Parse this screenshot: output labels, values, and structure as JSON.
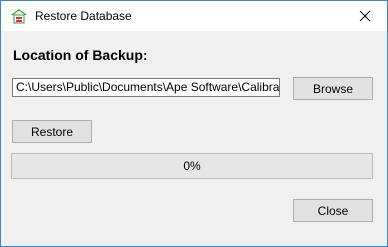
{
  "window": {
    "title": "Restore Database",
    "icon": "database-restore-icon",
    "close_icon": "close-icon"
  },
  "main": {
    "heading": "Location of Backup:",
    "path_value": "C:\\Users\\Public\\Documents\\Ape Software\\Calibration C",
    "browse_label": "Browse",
    "restore_label": "Restore",
    "progress_text": "0%",
    "progress_fraction": 0,
    "close_label": "Close"
  },
  "colors": {
    "window_border": "#3a84c9",
    "progress_fill": "#06b025"
  }
}
